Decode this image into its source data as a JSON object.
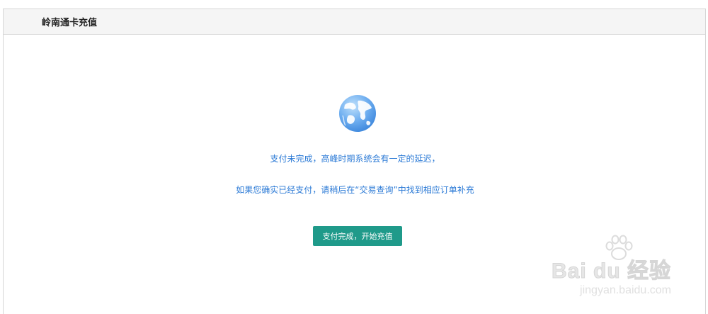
{
  "header": {
    "title": "岭南通卡充值"
  },
  "main": {
    "icon": "globe-icon",
    "message_line1": "支付未完成，高峰时期系统会有一定的延迟，",
    "message_line2": "如果您确实已经支付，请稍后在“交易查询”中找到相应订单补充",
    "button_label": "支付完成，开始充值"
  },
  "watermark": {
    "logo_text": "Bai du 经验",
    "url_text": "jingyan.baidu.com"
  },
  "colors": {
    "accent_text": "#2b7ad6",
    "button_bg": "#1f9a8a",
    "header_bg": "#f5f5f5"
  }
}
